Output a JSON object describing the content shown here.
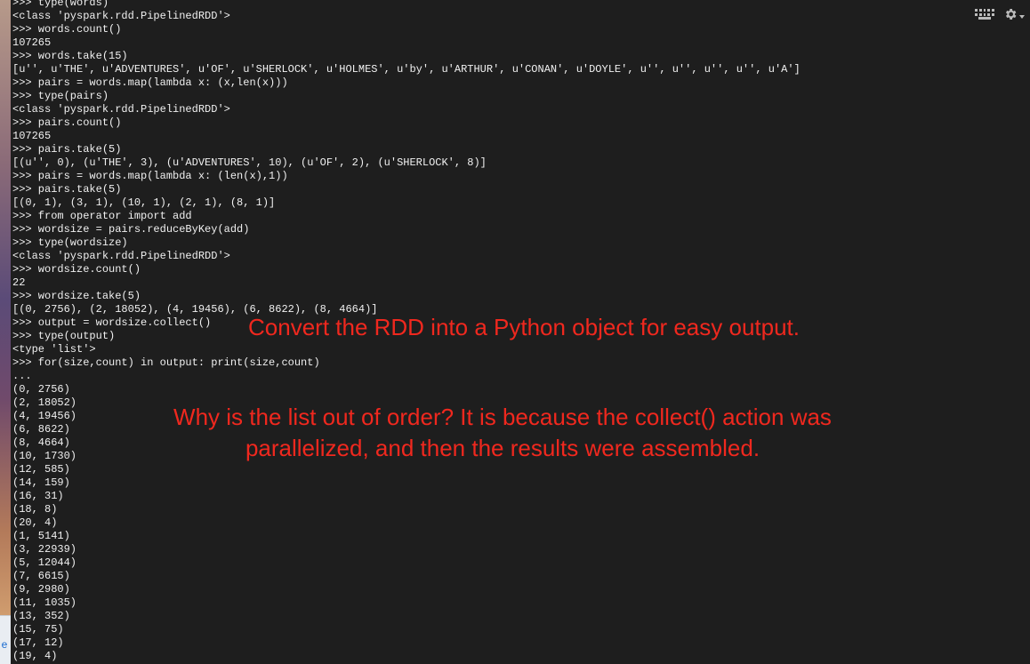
{
  "terminal": {
    "lines": [
      ">>> type(words)",
      "<class 'pyspark.rdd.PipelinedRDD'>",
      ">>> words.count()",
      "107265",
      ">>> words.take(15)",
      "[u'', u'THE', u'ADVENTURES', u'OF', u'SHERLOCK', u'HOLMES', u'by', u'ARTHUR', u'CONAN', u'DOYLE', u'', u'', u'', u'', u'A']",
      ">>> pairs = words.map(lambda x: (x,len(x)))",
      ">>> type(pairs)",
      "<class 'pyspark.rdd.PipelinedRDD'>",
      ">>> pairs.count()",
      "107265",
      ">>> pairs.take(5)",
      "[(u'', 0), (u'THE', 3), (u'ADVENTURES', 10), (u'OF', 2), (u'SHERLOCK', 8)]",
      ">>> pairs = words.map(lambda x: (len(x),1))",
      ">>> pairs.take(5)",
      "[(0, 1), (3, 1), (10, 1), (2, 1), (8, 1)]",
      ">>> from operator import add",
      ">>> wordsize = pairs.reduceByKey(add)",
      ">>> type(wordsize)",
      "<class 'pyspark.rdd.PipelinedRDD'>",
      ">>> wordsize.count()",
      "22",
      ">>> wordsize.take(5)",
      "[(0, 2756), (2, 18052), (4, 19456), (6, 8622), (8, 4664)]",
      ">>> output = wordsize.collect()",
      ">>> type(output)",
      "<type 'list'>",
      ">>> for(size,count) in output: print(size,count)",
      "...",
      "(0, 2756)",
      "(2, 18052)",
      "(4, 19456)",
      "(6, 8622)",
      "(8, 4664)",
      "(10, 1730)",
      "(12, 585)",
      "(14, 159)",
      "(16, 31)",
      "(18, 8)",
      "(20, 4)",
      "(1, 5141)",
      "(3, 22939)",
      "(5, 12044)",
      "(7, 6615)",
      "(9, 2980)",
      "(11, 1035)",
      "(13, 352)",
      "(15, 75)",
      "(17, 12)",
      "(19, 4)"
    ]
  },
  "annotations": {
    "convert": "Convert the RDD into a Python object for easy output.",
    "why_line1": "Why is the list out of order? It is because the collect() action was",
    "why_line2": "parallelized, and then the results were assembled."
  },
  "sidebar": {
    "letter": "e"
  },
  "icons": {
    "keyboard": "keyboard-icon",
    "settings": "gear-icon"
  },
  "colors": {
    "background": "#1e1e1e",
    "text": "#f0f0f0",
    "annotation": "#f0281e"
  }
}
